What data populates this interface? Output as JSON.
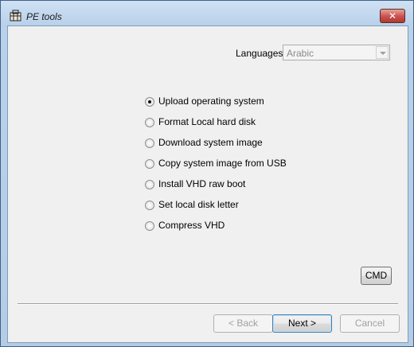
{
  "window": {
    "title": "PE tools",
    "close_label": "✕"
  },
  "languages": {
    "label": "Languages",
    "selected": "Arabic"
  },
  "options": [
    {
      "label": "Upload operating system",
      "checked": true
    },
    {
      "label": "Format Local hard disk",
      "checked": false
    },
    {
      "label": "Download system image",
      "checked": false
    },
    {
      "label": "Copy system image from USB",
      "checked": false
    },
    {
      "label": "Install VHD raw boot",
      "checked": false
    },
    {
      "label": "Set local disk letter",
      "checked": false
    },
    {
      "label": "Compress VHD",
      "checked": false
    }
  ],
  "buttons": {
    "cmd": "CMD",
    "back": "< Back",
    "next": "Next >",
    "cancel": "Cancel"
  },
  "icons": {
    "app": "toolbox-icon",
    "close": "close-icon",
    "dropdown": "chevron-down-icon"
  }
}
